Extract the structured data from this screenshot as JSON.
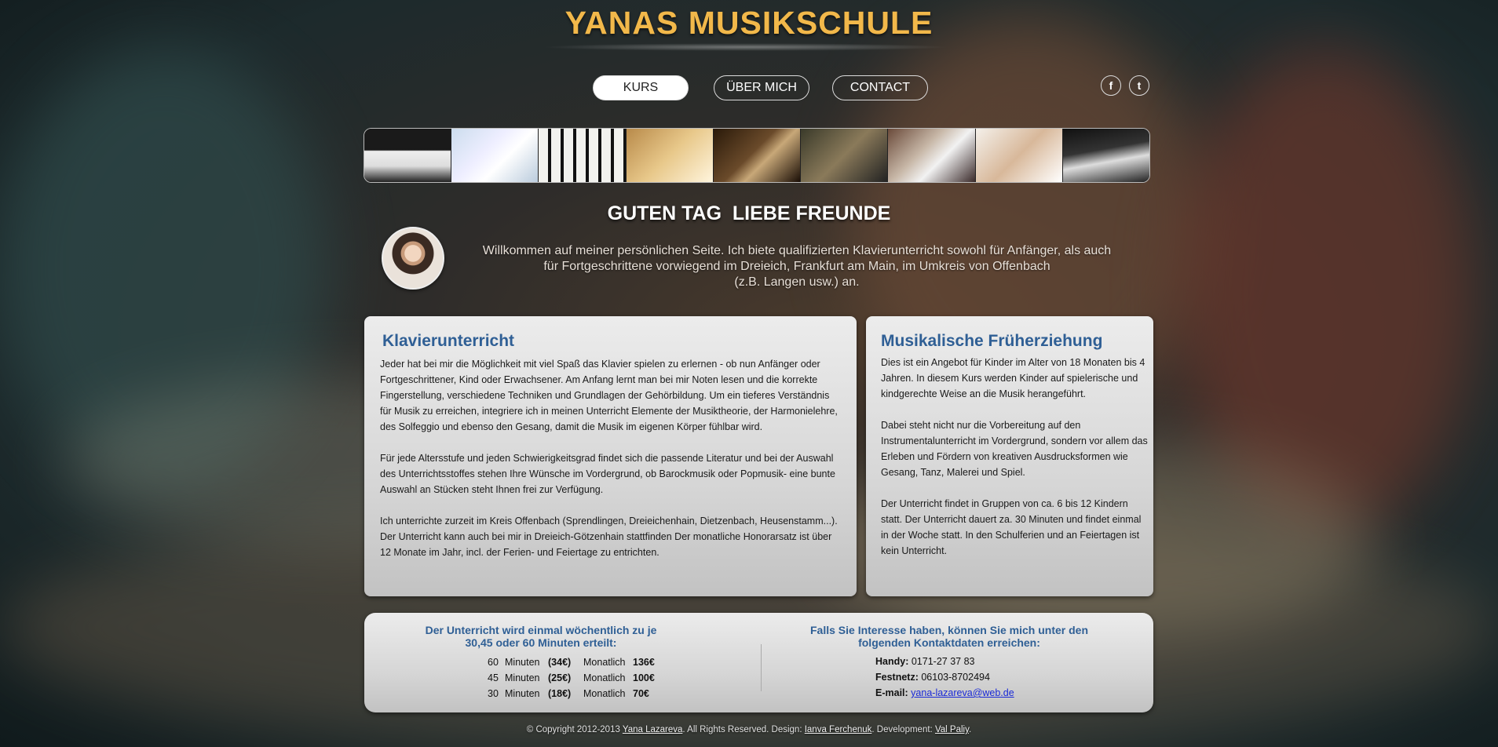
{
  "site_title": "YANAS MUSIKSCHULE",
  "nav": [
    {
      "label": "KURS",
      "active": true
    },
    {
      "label": "ÜBER MICH",
      "active": false
    },
    {
      "label": "CONTACT",
      "active": false
    }
  ],
  "social": [
    {
      "icon": "facebook-icon",
      "glyph": "f"
    },
    {
      "icon": "twitter-icon",
      "glyph": "t"
    }
  ],
  "gallery_count": 9,
  "greeting": "GUTEN TAG  LIEBE FREUNDE",
  "intro": {
    "line1": "Willkommen auf meiner persönlichen Seite. Ich biete qualifizierten Klavierunterricht sowohl für Anfänger, als auch",
    "line2": "für Fortgeschrittene vorwiegend im Dreieich, Frankfurt am Main, im Umkreis von Offenbach",
    "line3": "(z.B. Langen usw.) an."
  },
  "klavier": {
    "title": "Klavierunterricht",
    "p1": "Jeder hat bei mir die Möglichkeit mit viel Spaß das Klavier spielen zu erlernen - ob nun Anfänger oder Fortgeschrittener, Kind oder Erwachsener. Am Anfang lernt man bei mir Noten lesen und die korrekte Fingerstellung, verschiedene Techniken und Grundlagen der Gehörbildung. Um ein tieferes Verständnis für Musik zu erreichen, integriere ich in meinen Unterricht Elemente der Musiktheorie, der Harmonielehre, des Solfeggio und ebenso den Gesang, damit die Musik im eigenen Körper fühlbar wird.",
    "p2": "Für jede Altersstufe und jeden Schwierigkeitsgrad findet sich die passende Literatur und bei der Auswahl des Unterrichtsstoffes stehen Ihre Wünsche im Vordergrund, ob Barockmusik oder Popmusik- eine bunte Auswahl an Stücken steht Ihnen frei zur Verfügung.",
    "p3": "Ich unterrichte zurzeit im Kreis Offenbach (Sprendlingen, Dreieichenhain, Dietzenbach, Heusenstamm...). Der Unterricht kann auch bei mir in Dreieich-Götzenhain stattfinden Der monatliche Honorarsatz ist über 12 Monate im Jahr, incl. der Ferien- und Feiertage zu entrichten."
  },
  "frueh": {
    "title": "Musikalische Früherziehung",
    "p1": "Dies ist ein Angebot für Kinder im Alter von 18 Monaten bis 4 Jahren. In diesem Kurs werden Kinder auf spielerische und kindgerechte Weise an die Musik herangeführt.",
    "p2": "Dabei steht nicht nur die Vorbereitung auf den Instrumentalunterricht im Vordergrund, sondern vor allem das Erleben und Fördern von kreativen Ausdrucksformen wie Gesang, Tanz, Malerei und Spiel.",
    "p3": "Der Unterricht findet in Gruppen von ca. 6 bis 12 Kindern statt. Der Unterricht dauert za. 30 Minuten und findet einmal in der Woche statt. In den Schulferien und an Feiertagen ist kein Unterricht."
  },
  "pricing": {
    "heading": "Der Unterricht wird einmal wöchentlich zu je 30,45 oder 60 Minuten erteilt:",
    "rows": [
      {
        "min": "60",
        "unit": "Minuten",
        "per": "(34€)",
        "label": "Monatlich",
        "total": "136€"
      },
      {
        "min": "45",
        "unit": "Minuten",
        "per": "(25€)",
        "label": "Monatlich",
        "total": "100€"
      },
      {
        "min": "30",
        "unit": "Minuten",
        "per": "(18€)",
        "label": "Monatlich",
        "total": "70€"
      }
    ]
  },
  "contact": {
    "heading": "Falls Sie Interesse haben, können Sie mich unter den folgenden Kontaktdaten erreichen:",
    "handy_label": "Handy:",
    "handy": "0171-27 37 83",
    "festnetz_label": "Festnetz:",
    "festnetz": "06103-8702494",
    "email_label": "E-mail:",
    "email": "yana-lazareva@web.de"
  },
  "footer": {
    "copyright": "© Copyright 2012-2013",
    "owner": "Yana Lazareva",
    "rights": ". All Rights Reserved. Design:",
    "designer": "Ianva Ferchenuk",
    "dev_label": ". Development:",
    "developer": "Val Paliy",
    "end": "."
  }
}
